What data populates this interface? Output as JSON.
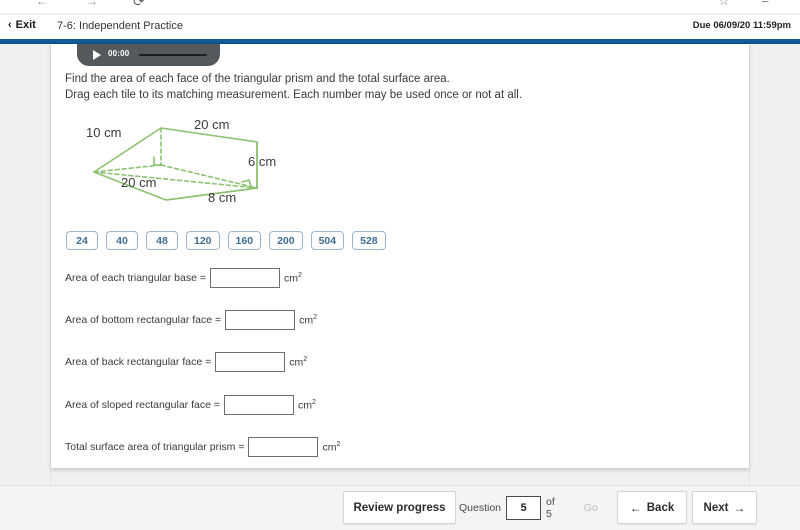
{
  "browser": {
    "icons": [
      "back-arrow-icon",
      "forward-arrow-icon",
      "reload-icon",
      "omnibox",
      "bookmark-star-icon",
      "extensions-icon"
    ]
  },
  "header": {
    "exit_label": "Exit",
    "exit_chevron": "‹",
    "title": "7-6: Independent Practice",
    "due": "Due 06/09/20 11:59pm",
    "rule_color": "#10598f"
  },
  "video": {
    "play_icon": "play-icon",
    "time": "00:00"
  },
  "instructions": {
    "line1": "Find the area of each face of the triangular prism and the total surface area.",
    "line2": "Drag each tile to its matching measurement. Each number may be used once or not at all."
  },
  "figure": {
    "shape": "triangular prism",
    "stroke_color": "#8cc271",
    "labels": {
      "slant_left": "10 cm",
      "top_length": "20 cm",
      "bottom_length": "20 cm",
      "height": "6 cm",
      "base": "8 cm"
    }
  },
  "tiles": [
    "24",
    "40",
    "48",
    "120",
    "160",
    "200",
    "504",
    "528"
  ],
  "answers": [
    {
      "label": "Area of each triangular base =",
      "value": "",
      "unit": "cm",
      "exponent": "2"
    },
    {
      "label": "Area of bottom rectangular face =",
      "value": "",
      "unit": "cm",
      "exponent": "2"
    },
    {
      "label": "Area of back rectangular face =",
      "value": "",
      "unit": "cm",
      "exponent": "2"
    },
    {
      "label": "Area of sloped rectangular face =",
      "value": "",
      "unit": "cm",
      "exponent": "2"
    },
    {
      "label": "Total surface area of triangular prism =",
      "value": "",
      "unit": "cm",
      "exponent": "2"
    }
  ],
  "bottom": {
    "review_label": "Review progress",
    "question_label": "Question",
    "question_value": "5",
    "of_label": "of 5",
    "go_label": "Go",
    "back_label": "Back",
    "back_arrow": "←",
    "next_label": "Next",
    "next_arrow": "→"
  }
}
